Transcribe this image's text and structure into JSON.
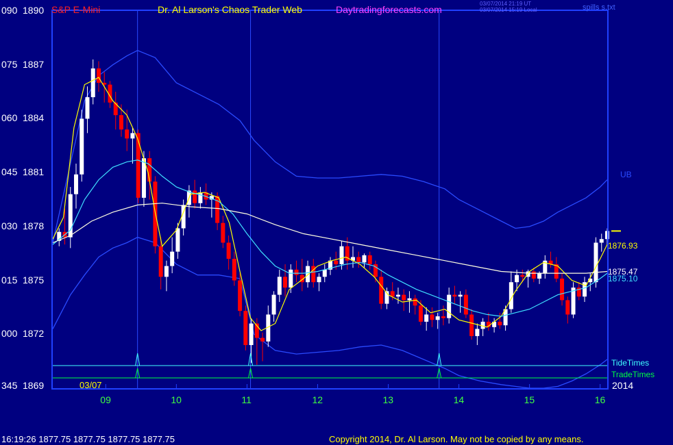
{
  "colors": {
    "background": "#000080",
    "frame": "#2040ff",
    "up_bar": "#ffffff",
    "down_bar": "#ff0000",
    "fast_ma": "#ffff00",
    "mid_ma": "#40e0ff",
    "slow_ma": "#ffffe0",
    "bands": "#2a4bff",
    "tide_line": "#40ffff",
    "trade_line": "#00ff40"
  },
  "header": {
    "symbol": "S&P E-Mini",
    "center_title": "Dr. Al Larson's Chaos Trader Web",
    "site": "Daytradingforecasts.com",
    "time_utc": "03/07/2014 21:19 UT",
    "time_local": "03/07/2014 15:19 Local",
    "right_label": "spills s.txt",
    "top_left_number": "090"
  },
  "footer": {
    "quote": "16:19:26  1877.75  1877.75  1877.75  1877.75",
    "copyright": "Copyright 2014, Dr. Al Larson. May not be copied by any means."
  },
  "chart_data": {
    "type": "candlestick",
    "title": "S&P E-Mini",
    "date_label": "03/07",
    "year_label": "2014",
    "y_ticks": [
      {
        "left": "090",
        "price": "1890",
        "value": 1890
      },
      {
        "left": "075",
        "price": "1887",
        "value": 1887
      },
      {
        "left": "060",
        "price": "1884",
        "value": 1884
      },
      {
        "left": "045",
        "price": "1881",
        "value": 1881
      },
      {
        "left": "030",
        "price": "1878",
        "value": 1878
      },
      {
        "left": "015",
        "price": "1875",
        "value": 1875
      },
      {
        "left": "000",
        "price": "1872",
        "value": 1872
      },
      {
        "left": "345",
        "price": "1869",
        "value": 1869
      }
    ],
    "ylim": [
      1869,
      1890
    ],
    "xlim": [
      8.25,
      16.1
    ],
    "x_ticks": [
      9,
      10,
      11,
      12,
      13,
      14,
      15,
      16
    ],
    "x_tick_labels": [
      "09",
      "10",
      "11",
      "12",
      "13",
      "14",
      "15",
      "16"
    ],
    "vertical_time_lines": [
      9.45,
      11.05,
      13.72
    ],
    "right_labels": [
      {
        "text": "UB",
        "value": 1880.9,
        "color": "#2a4bff"
      },
      {
        "text": "1876.93",
        "value": 1876.93,
        "color": "#ffff00"
      },
      {
        "text": "1875.47",
        "value": 1875.47,
        "color": "#ffffff"
      },
      {
        "text": "1875.10",
        "value": 1875.1,
        "color": "#40e0ff"
      }
    ],
    "last_price": 1877.75,
    "tide_times": {
      "label": "TideTimes",
      "spikes": [
        9.45,
        11.05,
        13.72
      ]
    },
    "trade_times": {
      "label": "TradeTimes",
      "spikes": [
        9.45,
        11.05,
        13.72
      ]
    },
    "series": [
      {
        "name": "",
        "kind": "ma_fast",
        "color": "#ffff00",
        "x": [
          8.25,
          8.4,
          8.55,
          8.7,
          8.9,
          9.1,
          9.3,
          9.45,
          9.6,
          9.7,
          9.8,
          10.0,
          10.2,
          10.4,
          10.6,
          10.75,
          10.9,
          11.05,
          11.2,
          11.4,
          11.6,
          11.8,
          12.0,
          12.2,
          12.4,
          12.6,
          12.8,
          13.0,
          13.2,
          13.4,
          13.6,
          13.8,
          14.0,
          14.2,
          14.4,
          14.6,
          14.8,
          15.0,
          15.2,
          15.4,
          15.6,
          15.8,
          16.0,
          16.1
        ],
        "y": [
          1877.3,
          1878.5,
          1883.5,
          1885.9,
          1886.3,
          1885.0,
          1884.2,
          1882.9,
          1881.0,
          1878.8,
          1876.9,
          1877.8,
          1879.8,
          1879.9,
          1879.6,
          1878.2,
          1875.5,
          1872.9,
          1872.2,
          1872.6,
          1874.5,
          1875.1,
          1875.8,
          1876.1,
          1876.3,
          1875.9,
          1875.2,
          1874.2,
          1873.8,
          1873.9,
          1873.2,
          1873.4,
          1872.8,
          1872.6,
          1872.4,
          1873.0,
          1874.4,
          1875.5,
          1876.0,
          1875.8,
          1875.0,
          1874.7,
          1876.2,
          1877.0
        ]
      },
      {
        "name": "",
        "kind": "ma_mid",
        "color": "#40e0ff",
        "x": [
          8.25,
          8.5,
          8.7,
          8.9,
          9.1,
          9.3,
          9.45,
          9.6,
          9.8,
          10.0,
          10.2,
          10.4,
          10.6,
          10.8,
          11.0,
          11.2,
          11.4,
          11.6,
          11.8,
          12.0,
          12.2,
          12.4,
          12.6,
          12.8,
          13.0,
          13.2,
          13.4,
          13.6,
          13.8,
          14.0,
          14.2,
          14.4,
          14.6,
          14.8,
          15.0,
          15.2,
          15.4,
          15.6,
          15.8,
          16.0,
          16.1
        ],
        "y": [
          1877.0,
          1877.8,
          1879.5,
          1880.6,
          1881.3,
          1881.6,
          1881.7,
          1881.5,
          1880.8,
          1880.2,
          1879.9,
          1879.7,
          1879.4,
          1878.7,
          1877.6,
          1876.6,
          1875.8,
          1875.4,
          1875.4,
          1875.5,
          1875.7,
          1875.9,
          1876.0,
          1875.8,
          1875.3,
          1874.9,
          1874.5,
          1874.2,
          1873.9,
          1873.6,
          1873.3,
          1873.1,
          1873.0,
          1873.2,
          1873.4,
          1873.8,
          1874.2,
          1874.4,
          1874.6,
          1875.1,
          1875.4
        ]
      },
      {
        "name": "",
        "kind": "ma_slow",
        "color": "#ffffe0",
        "x": [
          8.25,
          8.5,
          8.8,
          9.1,
          9.45,
          9.8,
          10.2,
          10.6,
          11.0,
          11.4,
          11.8,
          12.2,
          12.6,
          13.0,
          13.4,
          13.8,
          14.2,
          14.6,
          15.0,
          15.4,
          15.8,
          16.1
        ],
        "y": [
          1877.1,
          1877.5,
          1878.3,
          1878.8,
          1879.2,
          1879.3,
          1879.1,
          1879.0,
          1878.7,
          1878.1,
          1877.6,
          1877.3,
          1877.0,
          1876.7,
          1876.4,
          1876.1,
          1875.8,
          1875.5,
          1875.4,
          1875.4,
          1875.4,
          1875.5
        ]
      },
      {
        "name": "",
        "kind": "band_upper",
        "color": "#2a4bff",
        "x": [
          8.25,
          8.5,
          8.7,
          8.9,
          9.1,
          9.3,
          9.45,
          9.7,
          10.0,
          10.3,
          10.6,
          10.9,
          11.1,
          11.4,
          11.7,
          12.0,
          12.3,
          12.6,
          12.9,
          13.2,
          13.5,
          13.8,
          14.0,
          14.3,
          14.6,
          14.8,
          15.0,
          15.2,
          15.4,
          15.6,
          15.8,
          16.0,
          16.1
        ],
        "y": [
          1877.1,
          1881.5,
          1885.0,
          1886.4,
          1887.0,
          1887.5,
          1887.8,
          1887.4,
          1886.0,
          1885.4,
          1884.8,
          1883.9,
          1882.8,
          1881.6,
          1880.8,
          1880.7,
          1880.7,
          1880.8,
          1880.9,
          1880.8,
          1880.5,
          1880.1,
          1879.5,
          1878.9,
          1878.3,
          1877.9,
          1878.0,
          1878.3,
          1878.8,
          1879.2,
          1879.6,
          1880.2,
          1880.6
        ]
      },
      {
        "name": "",
        "kind": "band_lower",
        "color": "#2a4bff",
        "x": [
          8.25,
          8.5,
          8.7,
          8.9,
          9.1,
          9.3,
          9.45,
          9.7,
          10.0,
          10.3,
          10.6,
          10.9,
          11.1,
          11.4,
          11.7,
          12.0,
          12.3,
          12.6,
          12.9,
          13.2,
          13.5,
          13.8,
          14.0,
          14.3,
          14.6,
          14.8,
          15.0,
          15.2,
          15.4,
          15.6,
          15.8,
          16.0,
          16.1
        ],
        "y": [
          1872.3,
          1874.2,
          1875.3,
          1876.3,
          1876.8,
          1877.1,
          1877.4,
          1877.1,
          1875.9,
          1875.3,
          1875.3,
          1875.1,
          1872.0,
          1871.1,
          1870.9,
          1871.0,
          1871.1,
          1871.3,
          1871.4,
          1871.1,
          1870.6,
          1870.1,
          1869.7,
          1869.4,
          1869.2,
          1869.1,
          1869.0,
          1869.0,
          1869.1,
          1869.4,
          1869.8,
          1870.3,
          1870.6
        ]
      }
    ],
    "candles": [
      [
        8.34,
        1877.2,
        1877.9,
        1876.9,
        1877.7
      ],
      [
        8.42,
        1877.7,
        1879.0,
        1877.0,
        1877.4
      ],
      [
        8.5,
        1877.4,
        1880.2,
        1876.8,
        1879.8
      ],
      [
        8.58,
        1879.8,
        1881.5,
        1879.0,
        1880.9
      ],
      [
        8.66,
        1880.9,
        1884.5,
        1880.5,
        1884.0
      ],
      [
        8.74,
        1884.0,
        1885.8,
        1883.2,
        1885.2
      ],
      [
        8.82,
        1885.2,
        1887.3,
        1884.8,
        1886.8
      ],
      [
        8.9,
        1886.8,
        1887.2,
        1885.5,
        1886.0
      ],
      [
        8.98,
        1886.0,
        1886.6,
        1884.9,
        1885.9
      ],
      [
        9.06,
        1885.9,
        1886.1,
        1884.6,
        1884.9
      ],
      [
        9.14,
        1884.9,
        1885.5,
        1883.4,
        1884.2
      ],
      [
        9.22,
        1884.2,
        1884.8,
        1883.0,
        1883.4
      ],
      [
        9.3,
        1883.4,
        1884.5,
        1882.2,
        1882.9
      ],
      [
        9.38,
        1882.9,
        1883.5,
        1881.5,
        1883.2
      ],
      [
        9.46,
        1883.2,
        1883.4,
        1879.3,
        1879.6
      ],
      [
        9.54,
        1879.6,
        1882.2,
        1879.1,
        1881.8
      ],
      [
        9.62,
        1881.8,
        1882.2,
        1879.5,
        1880.5
      ],
      [
        9.7,
        1880.5,
        1880.8,
        1876.5,
        1876.9
      ],
      [
        9.78,
        1876.9,
        1877.4,
        1874.5,
        1875.2
      ],
      [
        9.86,
        1875.2,
        1876.1,
        1874.4,
        1875.8
      ],
      [
        9.94,
        1875.8,
        1877.4,
        1875.4,
        1876.6
      ],
      [
        10.02,
        1876.6,
        1878.2,
        1876.2,
        1877.9
      ],
      [
        10.1,
        1877.9,
        1879.5,
        1877.5,
        1879.2
      ],
      [
        10.18,
        1879.2,
        1880.3,
        1878.5,
        1880.0
      ],
      [
        10.26,
        1880.0,
        1880.6,
        1879.0,
        1879.3
      ],
      [
        10.34,
        1879.3,
        1880.2,
        1879.0,
        1879.9
      ],
      [
        10.42,
        1879.9,
        1880.4,
        1879.2,
        1879.5
      ],
      [
        10.5,
        1879.5,
        1879.9,
        1878.5,
        1879.7
      ],
      [
        10.58,
        1879.7,
        1879.9,
        1877.8,
        1878.2
      ],
      [
        10.66,
        1878.2,
        1878.6,
        1876.8,
        1877.1
      ],
      [
        10.74,
        1877.1,
        1877.5,
        1875.6,
        1876.2
      ],
      [
        10.82,
        1876.2,
        1876.6,
        1874.7,
        1875.0
      ],
      [
        10.9,
        1875.0,
        1875.4,
        1873.0,
        1873.3
      ],
      [
        10.98,
        1873.3,
        1873.6,
        1871.1,
        1871.4
      ],
      [
        11.06,
        1871.4,
        1872.9,
        1870.4,
        1872.6
      ],
      [
        11.14,
        1872.6,
        1872.9,
        1870.3,
        1871.8
      ],
      [
        11.22,
        1871.8,
        1872.1,
        1870.5,
        1871.6
      ],
      [
        11.3,
        1871.6,
        1873.6,
        1871.3,
        1873.1
      ],
      [
        11.38,
        1873.1,
        1874.4,
        1872.7,
        1874.2
      ],
      [
        11.46,
        1874.2,
        1875.6,
        1873.8,
        1875.2
      ],
      [
        11.54,
        1875.2,
        1875.9,
        1874.1,
        1874.6
      ],
      [
        11.62,
        1874.6,
        1875.9,
        1874.3,
        1875.6
      ],
      [
        11.7,
        1875.6,
        1876.1,
        1874.9,
        1875.3
      ],
      [
        11.78,
        1875.3,
        1876.2,
        1874.4,
        1874.9
      ],
      [
        11.86,
        1874.9,
        1876.1,
        1874.6,
        1875.8
      ],
      [
        11.94,
        1875.8,
        1876.2,
        1874.6,
        1874.9
      ],
      [
        12.02,
        1874.9,
        1875.4,
        1874.4,
        1875.2
      ],
      [
        12.1,
        1875.2,
        1875.9,
        1874.9,
        1875.6
      ],
      [
        12.18,
        1875.6,
        1876.3,
        1875.3,
        1876.1
      ],
      [
        12.26,
        1876.1,
        1876.6,
        1875.6,
        1875.9
      ],
      [
        12.34,
        1875.9,
        1877.2,
        1875.6,
        1876.9
      ],
      [
        12.42,
        1876.9,
        1877.4,
        1875.6,
        1876.1
      ],
      [
        12.5,
        1876.1,
        1876.9,
        1875.7,
        1876.3
      ],
      [
        12.58,
        1876.3,
        1876.6,
        1875.7,
        1876.0
      ],
      [
        12.66,
        1876.0,
        1876.5,
        1875.7,
        1876.4
      ],
      [
        12.74,
        1876.4,
        1876.6,
        1875.6,
        1875.9
      ],
      [
        12.82,
        1875.9,
        1876.1,
        1874.9,
        1875.2
      ],
      [
        12.9,
        1875.2,
        1875.6,
        1873.4,
        1873.7
      ],
      [
        12.98,
        1873.7,
        1874.6,
        1873.4,
        1874.4
      ],
      [
        13.06,
        1874.4,
        1874.9,
        1873.9,
        1874.1
      ],
      [
        13.14,
        1874.1,
        1874.6,
        1873.7,
        1874.2
      ],
      [
        13.22,
        1874.2,
        1874.5,
        1873.3,
        1873.9
      ],
      [
        13.3,
        1873.9,
        1874.4,
        1873.2,
        1874.0
      ],
      [
        13.38,
        1874.0,
        1874.2,
        1873.1,
        1873.6
      ],
      [
        13.46,
        1873.6,
        1873.9,
        1872.5,
        1872.7
      ],
      [
        13.54,
        1872.7,
        1873.5,
        1872.2,
        1873.1
      ],
      [
        13.62,
        1873.1,
        1873.5,
        1872.4,
        1872.8
      ],
      [
        13.7,
        1872.8,
        1873.2,
        1872.3,
        1873.0
      ],
      [
        13.78,
        1873.0,
        1873.6,
        1872.5,
        1872.9
      ],
      [
        13.86,
        1872.9,
        1874.6,
        1872.6,
        1874.2
      ],
      [
        13.94,
        1874.2,
        1874.7,
        1873.7,
        1874.1
      ],
      [
        14.02,
        1874.1,
        1874.4,
        1873.2,
        1874.2
      ],
      [
        14.1,
        1874.2,
        1874.5,
        1872.9,
        1873.1
      ],
      [
        14.18,
        1873.1,
        1873.4,
        1871.7,
        1871.9
      ],
      [
        14.26,
        1871.9,
        1872.6,
        1871.4,
        1872.3
      ],
      [
        14.34,
        1872.3,
        1872.9,
        1871.9,
        1872.7
      ],
      [
        14.42,
        1872.7,
        1873.2,
        1872.2,
        1872.4
      ],
      [
        14.5,
        1872.4,
        1872.9,
        1872.1,
        1872.7
      ],
      [
        14.58,
        1872.7,
        1873.2,
        1872.3,
        1872.5
      ],
      [
        14.66,
        1872.5,
        1873.6,
        1872.2,
        1873.4
      ],
      [
        14.74,
        1873.4,
        1875.5,
        1873.2,
        1874.9
      ],
      [
        14.82,
        1874.9,
        1875.6,
        1874.4,
        1875.3
      ],
      [
        14.9,
        1875.3,
        1875.6,
        1874.9,
        1875.2
      ],
      [
        14.98,
        1875.2,
        1875.6,
        1874.6,
        1875.5
      ],
      [
        15.06,
        1875.5,
        1875.7,
        1874.9,
        1875.1
      ],
      [
        15.14,
        1875.1,
        1875.5,
        1874.8,
        1875.4
      ],
      [
        15.22,
        1875.4,
        1876.4,
        1875.1,
        1876.1
      ],
      [
        15.3,
        1876.1,
        1876.6,
        1875.7,
        1875.9
      ],
      [
        15.38,
        1875.9,
        1876.3,
        1874.9,
        1875.1
      ],
      [
        15.46,
        1875.1,
        1875.4,
        1873.6,
        1873.9
      ],
      [
        15.54,
        1873.9,
        1874.1,
        1872.6,
        1873.1
      ],
      [
        15.62,
        1873.1,
        1874.9,
        1872.9,
        1874.6
      ],
      [
        15.7,
        1874.6,
        1874.9,
        1873.9,
        1874.1
      ],
      [
        15.78,
        1874.1,
        1875.2,
        1873.8,
        1874.9
      ],
      [
        15.86,
        1874.9,
        1875.4,
        1874.4,
        1875.1
      ],
      [
        15.94,
        1874.9,
        1877.4,
        1874.6,
        1877.1
      ],
      [
        16.02,
        1877.1,
        1877.6,
        1876.6,
        1877.3
      ],
      [
        16.1,
        1877.3,
        1877.9,
        1877.0,
        1877.75
      ]
    ]
  }
}
